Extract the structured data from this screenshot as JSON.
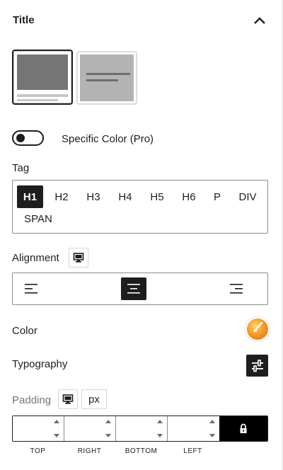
{
  "panel": {
    "title": "Title",
    "collapse_icon": "chevron-up-icon"
  },
  "layouts": [
    {
      "name": "image-above-text",
      "selected": true
    },
    {
      "name": "text-over-image",
      "selected": false
    }
  ],
  "specific_color": {
    "label": "Specific Color (Pro)",
    "enabled": false
  },
  "tag": {
    "label": "Tag",
    "options": [
      "H1",
      "H2",
      "H3",
      "H4",
      "H5",
      "H6",
      "P",
      "DIV",
      "SPAN"
    ],
    "selected": "H1"
  },
  "alignment": {
    "label": "Alignment",
    "device_icon": "desktop-icon",
    "options": [
      "left",
      "center",
      "right"
    ],
    "selected": "center"
  },
  "color": {
    "label": "Color",
    "swatch_icon": "paintbrush-icon",
    "accent": "#f39c2a"
  },
  "typography": {
    "label": "Typography",
    "icon": "sliders-icon"
  },
  "padding": {
    "label": "Padding",
    "device_icon": "desktop-icon",
    "unit": "px",
    "fields": [
      {
        "caption": "TOP",
        "value": ""
      },
      {
        "caption": "RIGHT",
        "value": ""
      },
      {
        "caption": "BOTTOM",
        "value": ""
      },
      {
        "caption": "LEFT",
        "value": ""
      }
    ],
    "lock_icon": "lock-icon"
  }
}
